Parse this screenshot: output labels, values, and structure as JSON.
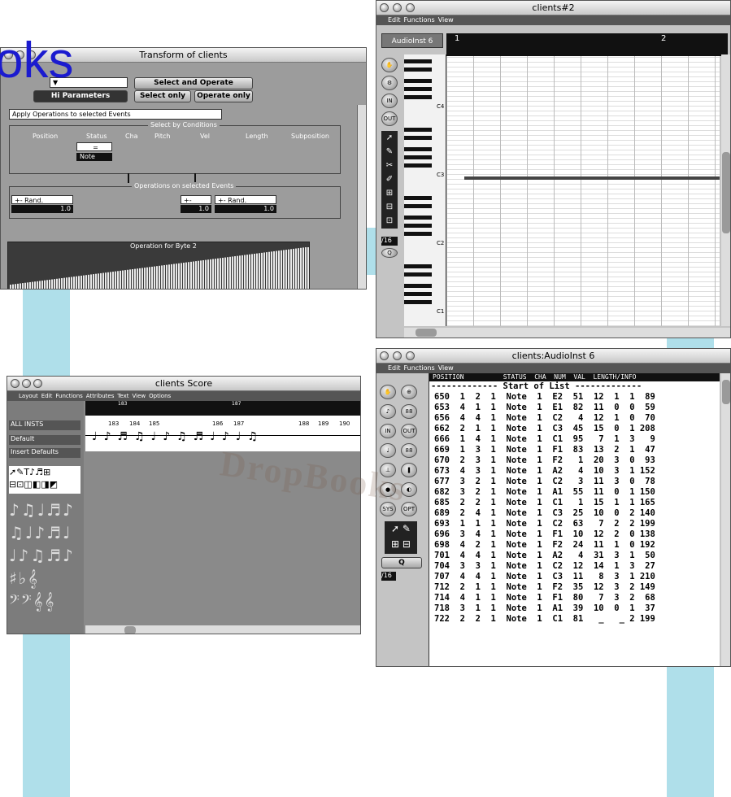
{
  "watermark": {
    "corner_text": "oks",
    "brand": "DropBooks"
  },
  "transform": {
    "title": "Transform of clients",
    "buttons": {
      "select_operate": "Select and Operate",
      "select_only": "Select only",
      "operate_only": "Operate only",
      "partial": "Hi  Parameters"
    },
    "apply_select": "Apply Operations to selected Events",
    "conditions_header": "Select by Conditions",
    "columns": [
      "Position",
      "Status",
      "Cha",
      "Pitch",
      "Vel",
      "Length",
      "Subposition"
    ],
    "status_op": "=",
    "status_val": "Note",
    "ops_header": "Operations on selected Events",
    "ops": [
      {
        "label": "+- Rand.",
        "val": "1.0"
      },
      {
        "label": "+- Rand.",
        "val": "1.0"
      },
      {
        "label": "+- Rand.",
        "val": "1.0"
      }
    ],
    "map_header": "Operation for Byte 2"
  },
  "matrix": {
    "title": "clients#2",
    "menu": [
      "Edit",
      "Functions",
      "View"
    ],
    "track": "AudioInst 6",
    "bars": [
      "1",
      "2"
    ],
    "octaves": [
      "C4",
      "C3",
      "C2",
      "C1"
    ],
    "quant": "/16"
  },
  "score": {
    "title": "clients Score",
    "menu": [
      "Layout",
      "Edit",
      "Functions",
      "Attributes",
      "Text",
      "View",
      "Options"
    ],
    "insts": "ALL INSTS",
    "default": "Default",
    "insert": "Insert Defaults",
    "bar_numbers": [
      "183",
      "184",
      "185",
      "186",
      "187",
      "188",
      "189",
      "190"
    ]
  },
  "eventlist": {
    "title": "clients:AudioInst 6",
    "menu": [
      "Edit",
      "Functions",
      "View"
    ],
    "header": "POSITION          STATUS  CHA  NUM  VAL  LENGTH/INFO",
    "start": "------------- Start of List -------------",
    "quant": "/16",
    "rows": [
      "650  1  2  1  Note  1  E2  51  12  1  1  89",
      "653  4  1  1  Note  1  E1  82  11  0  0  59",
      "656  4  4  1  Note  1  C2   4  12  1  0  70",
      "662  2  1  1  Note  1  C3  45  15  0  1 208",
      "666  1  4  1  Note  1  C1  95   7  1  3   9",
      "669  1  3  1  Note  1  F1  83  13  2  1  47",
      "670  2  3  1  Note  1  F2   1  20  3  0  93",
      "673  4  3  1  Note  1  A2   4  10  3  1 152",
      "677  3  2  1  Note  1  C2   3  11  3  0  78",
      "682  3  2  1  Note  1  A1  55  11  0  1 150",
      "685  2  2  1  Note  1  C1   1  15  1  1 165",
      "689  2  4  1  Note  1  C3  25  10  0  2 140",
      "693  1  1  1  Note  1  C2  63   7  2  2 199",
      "696  3  4  1  Note  1  F1  10  12  2  0 138",
      "698  4  2  1  Note  1  F2  24  11  1  0 192",
      "701  4  4  1  Note  1  A2   4  31  3  1  50",
      "704  3  3  1  Note  1  C2  12  14  1  3  27",
      "707  4  4  1  Note  1  C3  11   8  3  1 210",
      "712  2  1  1  Note  1  F2  35  12  3  2 149",
      "714  4  1  1  Note  1  F1  80   7  3  2  68",
      "718  3  1  1  Note  1  A1  39  10  0  1  37",
      "722  2  2  1  Note  1  C1  81   _   _ 2 199"
    ]
  }
}
